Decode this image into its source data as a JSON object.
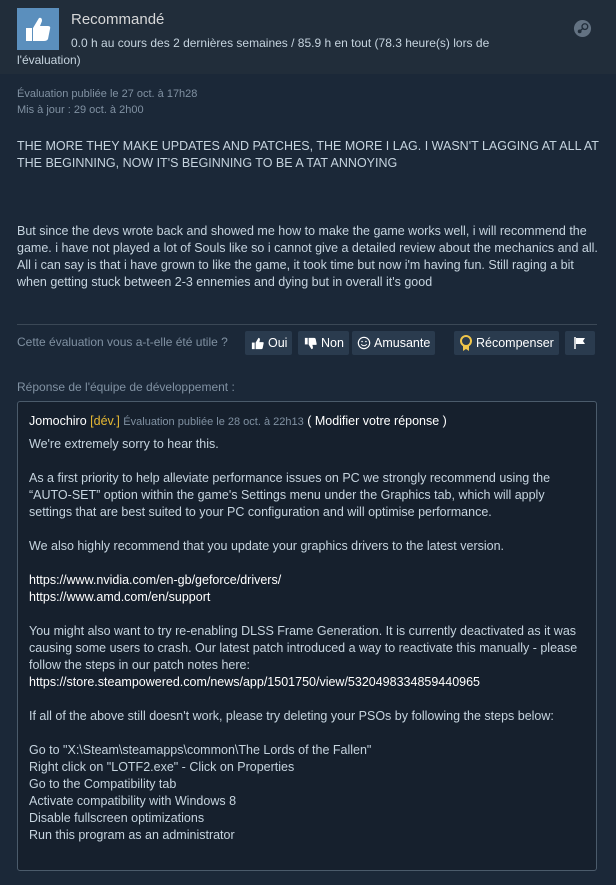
{
  "header": {
    "recommendation": "Recommandé",
    "hours": "0.0 h au cours des 2 dernières semaines / 85.9 h en tout (78.3 heure(s) lors de l'évaluation)"
  },
  "dates": {
    "posted": "Évaluation publiée le 27 oct. à 17h28",
    "updated": "Mis à jour : 29 oct. à 2h00"
  },
  "review": {
    "paragraph1": "THE MORE THEY MAKE UPDATES AND PATCHES, THE MORE I LAG. I WASN'T LAGGING AT ALL AT THE BEGINNING, NOW IT'S BEGINNING TO BE A TAT ANNOYING",
    "paragraph2": "But since the devs wrote back and showed me how to make the game works well, i will recommend the game. i have not played a lot of Souls like so i cannot give a detailed review about the mechanics and all. All i can say is that i have grown to like the game, it took time but now i'm having fun. Still raging a bit when getting stuck between 2-3 ennemies and dying but in overall it's good"
  },
  "helpful": {
    "question": "Cette évaluation vous a-t-elle été utile ?",
    "yes": "Oui",
    "no": "Non",
    "funny": "Amusante",
    "award": "Récompenser"
  },
  "developer_response": {
    "label": "Réponse de l'équipe de développement :",
    "author": "Jomochiro",
    "tag": "[dév.]",
    "posted": "Évaluation publiée le 28 oct. à 22h13",
    "edit": "( Modifier votre réponse )",
    "p1": "We're extremely sorry to hear this.",
    "p2": "As a first priority to help alleviate performance issues on PC we strongly recommend using the “AUTO-SET” option within the game's Settings menu under the Graphics tab, which will apply settings that are best suited to your PC configuration and will optimise performance.",
    "p3": "We also highly recommend that you update your graphics drivers to the latest version.",
    "link_nvidia": "https://www.nvidia.com/en-gb/geforce/drivers/",
    "link_amd": "https://www.amd.com/en/support",
    "p4": "You might also want to try re-enabling DLSS Frame Generation. It is currently deactivated as it was causing some users to crash. Our latest patch introduced a way to reactivate this manually - please follow the steps in our patch notes here:",
    "link_patch": "https://store.steampowered.com/news/app/1501750/view/5320498334859440965",
    "p5": "If all of the above still doesn't work, please try deleting your PSOs by following the steps below:",
    "steps": [
      "Go to \"X:\\Steam\\steamapps\\common\\The Lords of the Fallen\"",
      "Right click on \"LOTF2.exe\" - Click on Properties",
      "Go to the Compatibility tab",
      "Activate compatibility with Windows 8",
      "Disable fullscreen optimizations",
      "Run this program as an administrator"
    ]
  }
}
